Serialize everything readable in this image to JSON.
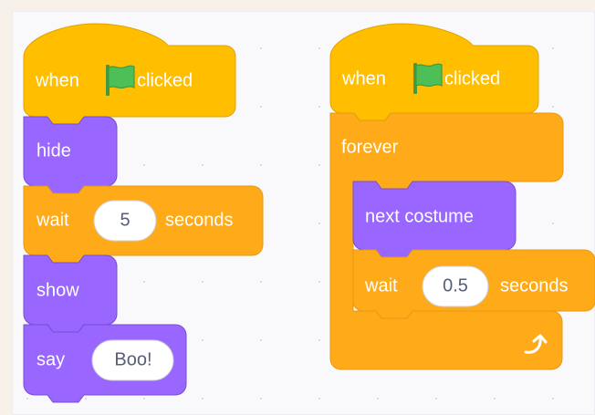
{
  "scripts": [
    {
      "hat": {
        "before": "when",
        "icon": "green-flag-icon",
        "after": "clicked"
      },
      "blocks": [
        {
          "label": "hide"
        },
        {
          "label": "wait",
          "input": "5",
          "suffix": "seconds"
        },
        {
          "label": "show"
        },
        {
          "label": "say",
          "input": "Boo!"
        }
      ]
    },
    {
      "hat": {
        "before": "when",
        "icon": "green-flag-icon",
        "after": "clicked"
      },
      "forever": {
        "label": "forever",
        "loop_icon": "loop-arrow-icon",
        "blocks": [
          {
            "label": "next costume"
          },
          {
            "label": "wait",
            "input": "0.5",
            "suffix": "seconds"
          }
        ]
      }
    }
  ],
  "colors": {
    "events": "#ffbf00",
    "looks": "#9966ff",
    "control": "#ffab19",
    "flag": "#4cbf56"
  }
}
